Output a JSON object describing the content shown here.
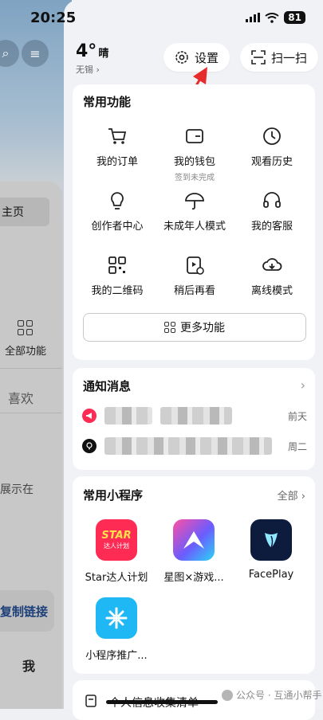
{
  "status_bar": {
    "time": "20:25",
    "battery": "81"
  },
  "left_panel": {
    "home_label": "主页",
    "all_features_label": "全部功能",
    "likes_label": "喜欢",
    "show_text": "展示在",
    "copy_link": "复制链接",
    "me_label": "我"
  },
  "weather": {
    "temperature": "4°",
    "condition": "晴",
    "city": "无锡 ›"
  },
  "top_actions": {
    "settings_label": "设置",
    "scan_label": "扫一扫"
  },
  "common_features": {
    "title": "常用功能",
    "items": [
      {
        "label": "我的订单",
        "icon": "cart-icon"
      },
      {
        "label": "我的钱包",
        "icon": "wallet-icon",
        "sub": "签到未完成"
      },
      {
        "label": "观看历史",
        "icon": "clock-icon"
      },
      {
        "label": "创作者中心",
        "icon": "bulb-icon"
      },
      {
        "label": "未成年人模式",
        "icon": "umbrella-icon"
      },
      {
        "label": "我的客服",
        "icon": "headset-icon"
      },
      {
        "label": "我的二维码",
        "icon": "qrcode-icon"
      },
      {
        "label": "稍后再看",
        "icon": "watch-later-icon"
      },
      {
        "label": "离线模式",
        "icon": "cloud-download-icon"
      }
    ],
    "more_label": "更多功能"
  },
  "notifications": {
    "title": "通知消息",
    "items": [
      {
        "time": "前天",
        "icon": "megaphone-icon",
        "color": "#fe2c55"
      },
      {
        "time": "周二",
        "icon": "bulb-icon",
        "color": "#111111"
      }
    ]
  },
  "mini_programs": {
    "title": "常用小程序",
    "all_label": "全部 ›",
    "items": [
      {
        "label": "Star达人计划",
        "logo_text": "STAR",
        "logo_sub": "达人计划",
        "color": "#fe2c55"
      },
      {
        "label": "星图×游戏...",
        "color": "#6b5cff"
      },
      {
        "label": "FacePlay",
        "color": "#0d1b3d"
      },
      {
        "label": "小程序推广...",
        "color": "#1fb8f5"
      }
    ]
  },
  "bottom_card": {
    "title": "个人信息收集清单"
  },
  "watermark": "公众号 · 互通小帮手"
}
